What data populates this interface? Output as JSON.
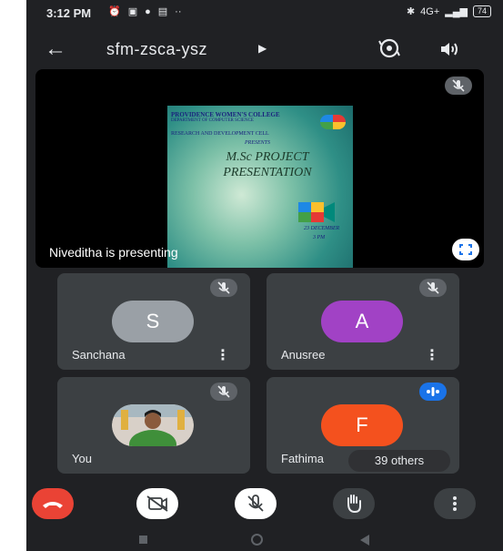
{
  "status_bar": {
    "time": "3:12 PM",
    "network": "4G+",
    "battery": "74"
  },
  "header": {
    "meeting_code": "sfm-zsca-ysz"
  },
  "presentation": {
    "presenter_label": "Niveditha is presenting",
    "slide": {
      "college": "PROVIDENCE WOMEN'S COLLEGE",
      "department": "DEPARTMENT OF COMPUTER SCIENCE",
      "cell": "RESEARCH AND DEVELOPMENT CELL",
      "presents": "PRESENTS",
      "heading": "M.Sc PROJECT PRESENTATION",
      "date": "23 DECEMBER",
      "time": "3 PM"
    }
  },
  "participants": [
    {
      "name": "Sanchana",
      "initial": "S",
      "avatar_color": "#9aa0a6",
      "muted": true
    },
    {
      "name": "Anusree",
      "initial": "A",
      "avatar_color": "#a142c5",
      "muted": true
    },
    {
      "name": "You",
      "initial": "",
      "avatar_color": "#7a9a6a",
      "muted": true
    },
    {
      "name": "Fathima",
      "initial": "F",
      "avatar_color": "#f4511e",
      "muted": false,
      "speaking": true
    }
  ],
  "others_label": "39 others",
  "colors": {
    "end_call": "#ea4335",
    "control_bg": "#ffffff",
    "control_dark": "#3c4043",
    "speaking_blue": "#1a73e8"
  }
}
